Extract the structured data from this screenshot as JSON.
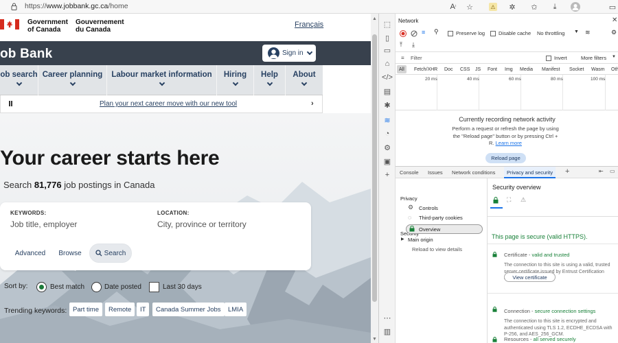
{
  "browser": {
    "url_prefix": "https://",
    "url_host": "www.jobbank.gc.ca",
    "url_path": "/home"
  },
  "page": {
    "gov_en_line1": "Government",
    "gov_en_line2": "of Canada",
    "gov_fr_line1": "Gouvernement",
    "gov_fr_line2": "du Canada",
    "language_link": "Français",
    "site_title": "ob Bank",
    "sign_in": "Sign in",
    "nav": [
      "ob search",
      "Career planning",
      "Labour market information",
      "Hiring",
      "Help",
      "About"
    ],
    "promo_link": "Plan your next career move with our new tool",
    "hero_title": "Your career starts here",
    "search_prefix": "Search",
    "search_count": "81,776",
    "search_suffix": "job postings in Canada",
    "keywords_label": "KEYWORDS:",
    "keywords_placeholder": "Job title, employer",
    "location_label": "LOCATION:",
    "location_placeholder": "City, province or territory",
    "advanced": "Advanced",
    "browse": "Browse",
    "search_button": "Search",
    "sort_label": "Sort by:",
    "sort_best": "Best match",
    "sort_date": "Date posted",
    "last30": "Last 30 days",
    "sort_selected": "Best match",
    "trending_label": "Trending keywords:",
    "trending": [
      "Part time",
      "Remote",
      "IT",
      "Canada Summer Jobs",
      "LMIA"
    ]
  },
  "devtools": {
    "panel_title": "Network",
    "preserve_log": "Preserve log",
    "disable_cache": "Disable cache",
    "throttling": "No throttling",
    "filter_placeholder": "Filter",
    "invert": "Invert",
    "more_filters": "More filters",
    "types": [
      "All",
      "Fetch/XHR",
      "Doc",
      "CSS",
      "JS",
      "Font",
      "Img",
      "Media",
      "Manifest",
      "Socket",
      "Wasm",
      "Oth"
    ],
    "ticks": [
      "20 ms",
      "40 ms",
      "60 ms",
      "80 ms",
      "100 ms"
    ],
    "recording_title": "Currently recording network activity",
    "recording_line1": "Perform a request or refresh the page by using",
    "recording_line2": "the \"Reload page\" button or by pressing Ctrl +",
    "recording_line3": "R.",
    "learn_more": "Learn more",
    "reload_button": "Reload page",
    "drawer_tabs": [
      "Console",
      "Issues",
      "Network conditions",
      "Privacy and security"
    ],
    "tree": {
      "privacy": "Privacy",
      "controls": "Controls",
      "third_party": "Third-party cookies",
      "security": "Security",
      "overview": "Overview",
      "main_origin": "Main origin",
      "reload_note": "Reload to view details"
    },
    "security": {
      "title": "Security overview",
      "secure_msg": "This page is secure (valid HTTPS).",
      "cert_label": "Certificate",
      "cert_status": "valid and trusted",
      "cert_desc": "The connection to this site is using a valid, trusted server certificate issued by Entrust Certification Authority - L1F.",
      "view_cert": "View certificate",
      "conn_label": "Connection",
      "conn_status": "secure connection settings",
      "conn_desc": "The connection to this site is encrypted and authenticated using TLS 1.2, ECDHE_ECDSA with P-256, and AES_256_GCM.",
      "res_label": "Resources",
      "res_status": "all served securely"
    }
  },
  "colors": {
    "gc_navy": "#284162",
    "jobbank_bar": "#38414d",
    "secure_green": "#188038",
    "canada_red": "#d52b1e"
  }
}
